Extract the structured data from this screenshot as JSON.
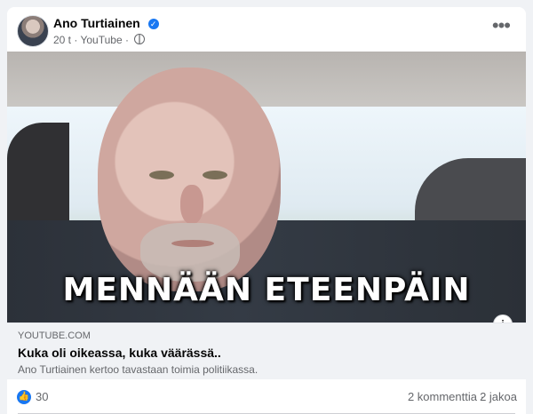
{
  "post": {
    "author": "Ano Turtiainen",
    "meta": {
      "time": "20 t",
      "separator": "·",
      "source": "YouTube",
      "separator2": "·"
    },
    "menu_label": "•••",
    "verified_symbol": "✓"
  },
  "video": {
    "overlay_text": "MENNÄÄN ETEENPÄIN",
    "info_label": "i"
  },
  "link": {
    "source": "YOUTUBE.COM",
    "title": "Kuka oli oikeassa, kuka väärässä..",
    "description": "Ano Turtiainen kertoo tavastaan toimia politiikassa."
  },
  "stats": {
    "reaction_icon": "👍",
    "likes": "30",
    "comments": "2 kommenttia",
    "separator": "·",
    "shares": "2 jakoa"
  },
  "colors": {
    "accent": "#1877f2",
    "secondary_text": "#65676b",
    "background": "#f0f2f5"
  }
}
